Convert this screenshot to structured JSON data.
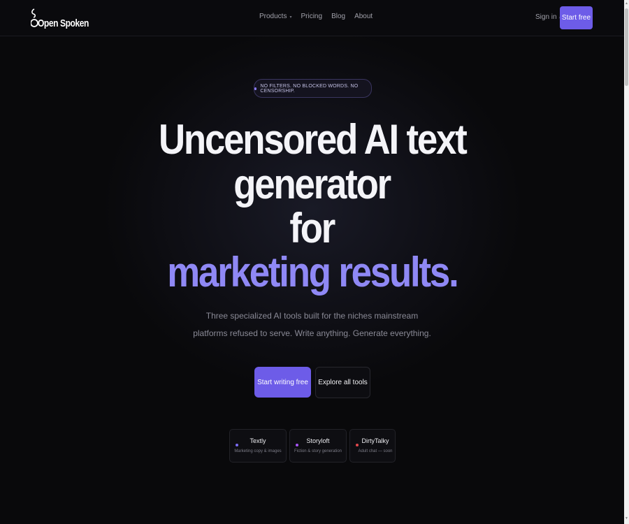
{
  "nav": {
    "logo_text": "Open Spoken",
    "links": [
      {
        "label": "Products",
        "has_dropdown": true
      },
      {
        "label": "Pricing"
      },
      {
        "label": "Blog"
      },
      {
        "label": "About"
      }
    ],
    "sign_in": "Sign in",
    "start_free": "Start free"
  },
  "hero": {
    "badge": "NO FILTERS. NO BLOCKED WORDS. NO CENSORSHIP.",
    "title_line1": "Uncensored AI text",
    "title_line2": "generator",
    "title_line3": "for",
    "title_line4": "marketing results.",
    "subtitle_line1": "Three specialized AI tools built for the niches mainstream",
    "subtitle_line2": "platforms refused to serve. Write anything. Generate everything.",
    "primary_cta": "Start writing free",
    "secondary_cta": "Explore all tools"
  },
  "tools": [
    {
      "name": "Textly",
      "desc": "Marketing copy & images",
      "dot_color": "#7c6cf5"
    },
    {
      "name": "Storyloft",
      "desc": "Fiction & story generation",
      "dot_color": "#a855f7"
    },
    {
      "name": "DirtyTalky",
      "desc": "Adult chat — soon",
      "dot_color": "#e5484d"
    }
  ],
  "colors": {
    "accent": "#6d5ce8",
    "highlight_text": "#8f88f5",
    "background": "#09090b"
  }
}
